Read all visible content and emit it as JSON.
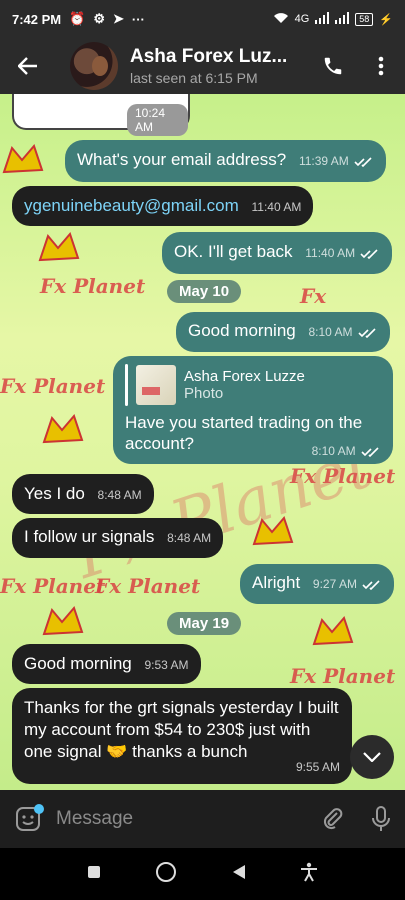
{
  "status": {
    "time": "7:42 PM",
    "network": "4G",
    "battery": "58"
  },
  "header": {
    "title": "Asha Forex Luz...",
    "subtitle": "last seen at 6:15 PM"
  },
  "watermark": {
    "text": "Fx Planet"
  },
  "messages": [
    {
      "text": "What's your email address?",
      "time": "11:39 AM"
    },
    {
      "text": "ygenuinebeauty@gmail.com",
      "time": "11:40 AM"
    },
    {
      "text": "OK. I'll get back",
      "time": "11:40 AM"
    },
    {
      "text": "Good morning",
      "time": "8:10 AM"
    },
    {
      "text": "Have you started trading on the account?",
      "time": "8:10 AM",
      "reply_name": "Asha Forex Lu​zze",
      "reply_type": "Photo"
    },
    {
      "text": "Yes I do",
      "time": "8:48 AM"
    },
    {
      "text": "I follow ur signals",
      "time": "8:48 AM"
    },
    {
      "text": "Alright",
      "time": "9:27 AM"
    },
    {
      "text": "Good morning",
      "time": "9:53 AM"
    },
    {
      "text": "Thanks for the grt signals yesterday I built my account from $54 to 230$ just with one signal 🤝 thanks a bunch",
      "time": "9:55 AM"
    }
  ],
  "photo_time": "10:24 AM",
  "dates": [
    "May 10",
    "May 19"
  ],
  "input": {
    "placeholder": "Message"
  },
  "colors": {
    "incoming": "#1f1f1f",
    "outgoing": "#3f7d78",
    "header": "#2b2b2b"
  }
}
